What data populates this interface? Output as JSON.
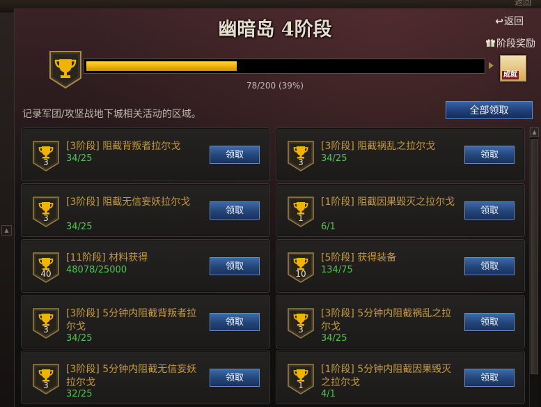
{
  "header": {
    "title": "幽暗岛 4阶段",
    "back_label": "返回",
    "back_top_label": "返回",
    "reward_label": "阶段奖励",
    "reward_item_label": "成就"
  },
  "progress": {
    "text": "78/200 (39%)",
    "fraction": 0.39
  },
  "description": "记录军团/攻坚战地下城相关活动的区域。",
  "claim_all_label": "全部领取",
  "colors": {
    "title_text": "#e6dccb",
    "quest_title": "#c59a3c",
    "quest_progress": "#4cc74c",
    "progress_fill": "#f0b000",
    "button_blue": "#234579"
  },
  "quests": [
    {
      "title": "[3阶段] 阻截背叛者拉尔戈",
      "progress": "34/25",
      "level": "3",
      "button": "领取"
    },
    {
      "title": "[3阶段] 阻截祸乱之拉尔戈",
      "progress": "34/25",
      "level": "3",
      "button": "领取"
    },
    {
      "title": "[3阶段] 阻截无信妄妖拉尔戈",
      "progress": "34/25",
      "level": "3",
      "button": "领取"
    },
    {
      "title": "[1阶段] 阻截因果毁灭之拉尔戈",
      "progress": "6/1",
      "level": "1",
      "button": "领取"
    },
    {
      "title": "[11阶段] 材料获得",
      "progress": "48078/25000",
      "level": "40",
      "button": "领取"
    },
    {
      "title": "[5阶段] 获得装备",
      "progress": "134/75",
      "level": "10",
      "button": "领取"
    },
    {
      "title": "[3阶段] 5分钟内阻截背叛者拉尔戈",
      "progress": "34/25",
      "level": "3",
      "button": "领取"
    },
    {
      "title": "[3阶段] 5分钟内阻截祸乱之拉尔戈",
      "progress": "34/25",
      "level": "3",
      "button": "领取"
    },
    {
      "title": "[3阶段] 5分钟内阻截无信妄妖拉尔戈",
      "progress": "32/25",
      "level": "3",
      "button": "领取"
    },
    {
      "title": "[1阶段] 5分钟内阻截因果毁灭之拉尔戈",
      "progress": "4/1",
      "level": "1",
      "button": "领取"
    }
  ],
  "icons": {
    "trophy": "trophy-icon",
    "back": "back-arrow-icon",
    "gift": "gift-icon"
  }
}
